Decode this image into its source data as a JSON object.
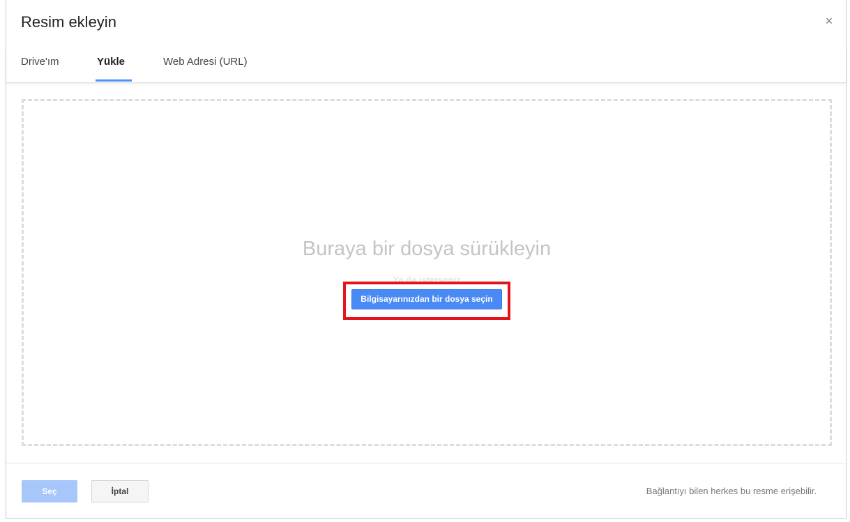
{
  "dialog": {
    "title": "Resim ekleyin",
    "close_icon": "×"
  },
  "tabs": [
    {
      "label": "Drive'ım",
      "active": false
    },
    {
      "label": "Yükle",
      "active": true
    },
    {
      "label": "Web Adresi (URL)",
      "active": false
    }
  ],
  "dropzone": {
    "drag_text": "Buraya bir dosya sürükleyin",
    "or_text": "Ya da isterseniz",
    "select_button": "Bilgisayarınızdan bir dosya seçin"
  },
  "footer": {
    "select_button": "Seç",
    "cancel_button": "İptal",
    "note": "Bağlantıyı bilen herkes bu resme erişebilir."
  },
  "colors": {
    "accent": "#4d90fe",
    "primary_button": "#4a8af4",
    "disabled_button": "#a7c6f9",
    "highlight_box": "#e3141c"
  }
}
